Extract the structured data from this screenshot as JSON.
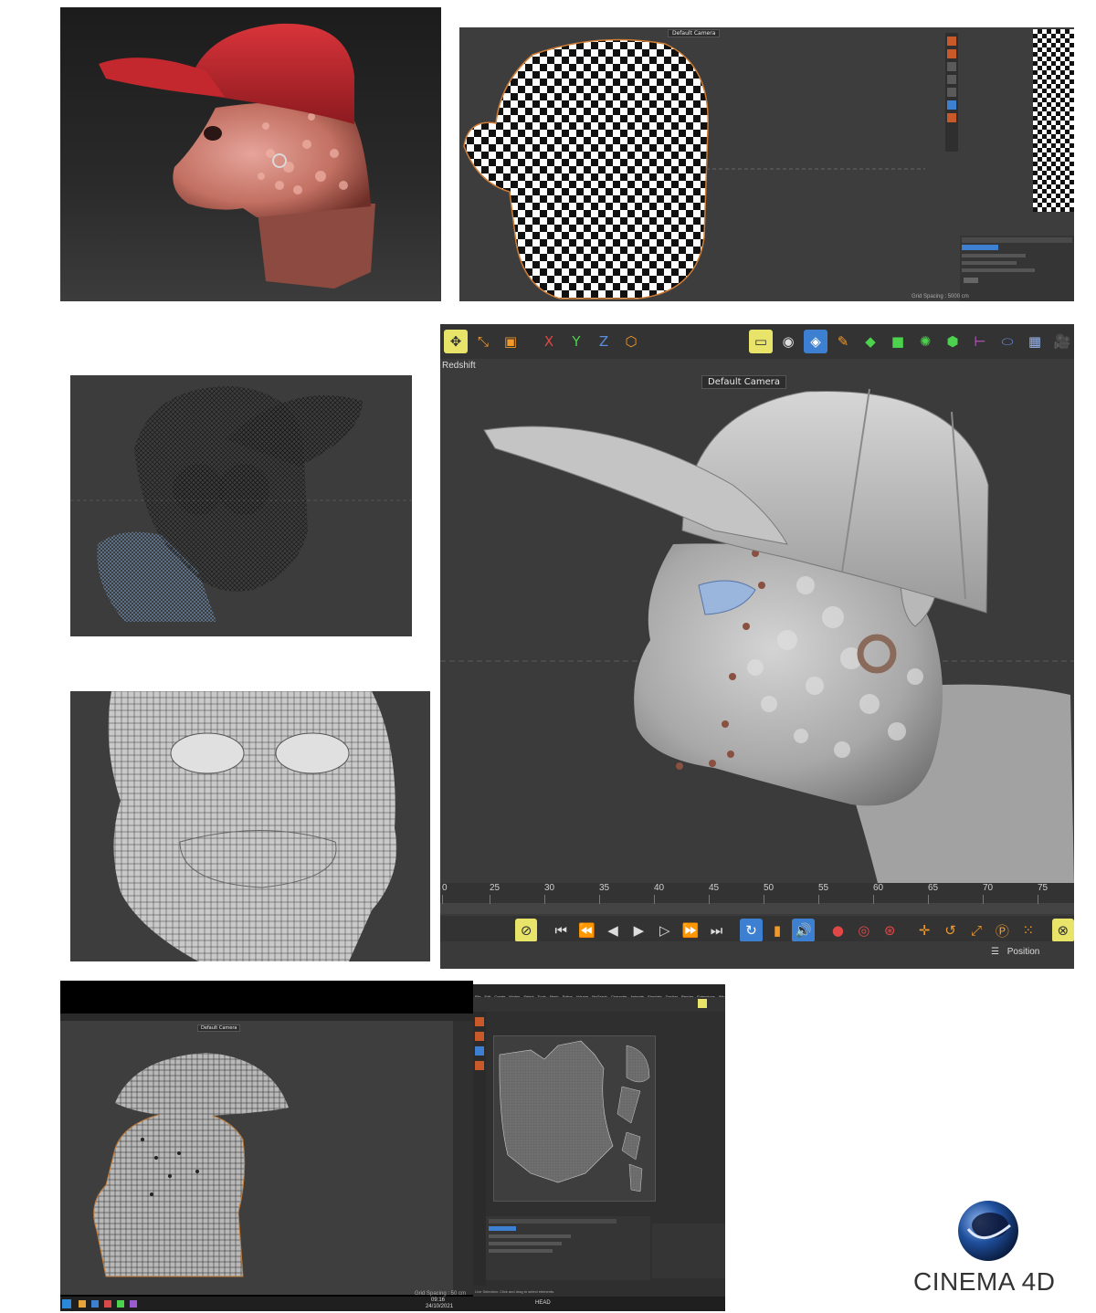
{
  "top_right_panel": {
    "camera_label": "Default Camera",
    "status_text": "Grid Spacing : 5000 cm"
  },
  "main_viewport": {
    "renderer_label": "Redshift",
    "camera_label": "Default Camera",
    "toolbar_icons": [
      "move-tool-icon",
      "scale-tool-icon",
      "rotate-tool-icon",
      "x-axis-icon",
      "y-axis-icon",
      "z-axis-icon",
      "coordinate-system-icon",
      "render-region-icon",
      "render-view-icon",
      "cube-icon",
      "pen-icon",
      "subdivision-icon",
      "array-icon",
      "cloner-icon",
      "mograph-icon",
      "deformer-icon",
      "field-icon",
      "sky-icon",
      "camera-icon"
    ],
    "axis_labels": {
      "x": "X",
      "y": "Y",
      "z": "Z"
    },
    "timeline_ticks": [
      "0",
      "25",
      "30",
      "35",
      "40",
      "45",
      "50",
      "55",
      "60",
      "65",
      "70",
      "75"
    ],
    "position_label": "Position"
  },
  "bottom_left_panel": {
    "camera_label": "Default Camera",
    "status_text": "Grid Spacing : 50 cm"
  },
  "bottom_uv_panel": {
    "menu_items": [
      "File",
      "Edit",
      "Create",
      "Modes",
      "Select",
      "Tools",
      "Mesh",
      "Spline",
      "Volume",
      "MoGraph",
      "Character",
      "Animate",
      "Simulate",
      "Tracker",
      "Render",
      "Extensions",
      "Window",
      "Help"
    ],
    "status_text": "Live Selection: Click and drag to select elements."
  },
  "taskbar": {
    "time": "09:16",
    "date": "24/10/2021",
    "file_label": "HEAD"
  },
  "brand": {
    "logo_text": "CINEMA 4D"
  },
  "colors": {
    "viewport_gray": "#3b3b3b",
    "toolbar_highlight": "#e8e46a",
    "cap_red": "#b2232a",
    "skin_pink": "#c98074",
    "logo_blue": "#1f4f9c"
  }
}
